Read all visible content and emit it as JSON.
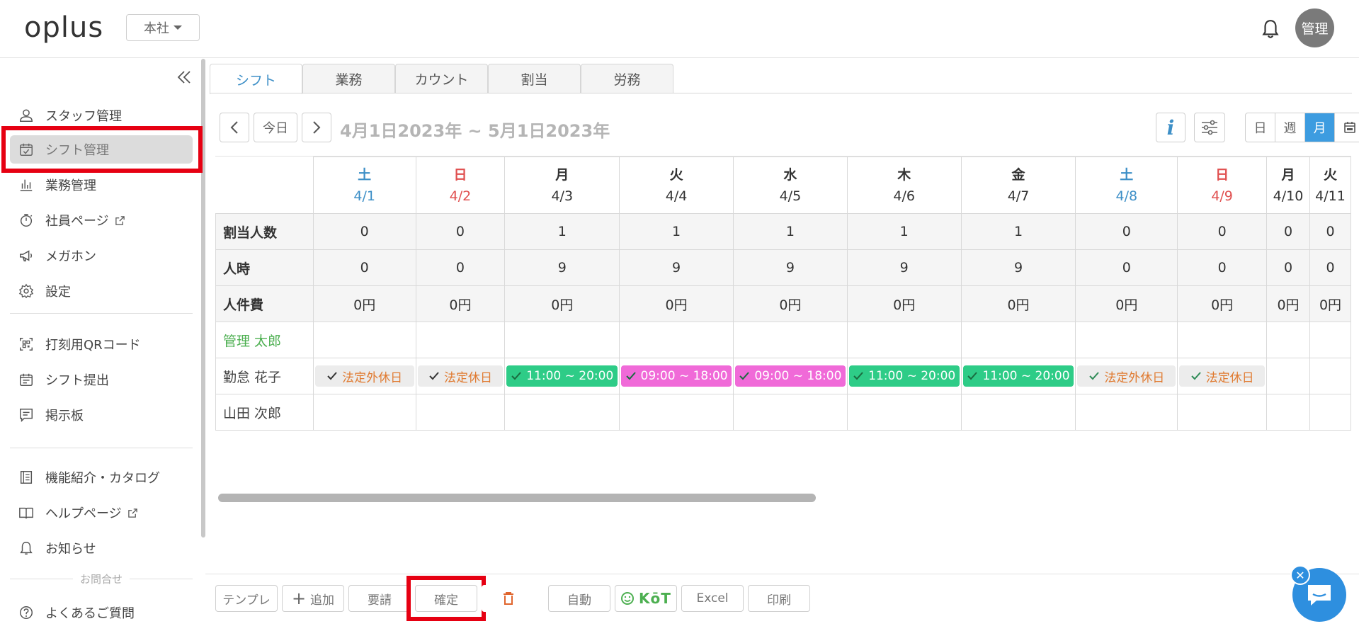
{
  "header": {
    "logo": "oplus",
    "branch": "本社",
    "avatar": "管理"
  },
  "sidebar": {
    "items": [
      {
        "label": "スタッフ管理",
        "icon": "user-icon"
      },
      {
        "label": "シフト管理",
        "icon": "calendar-check-icon"
      },
      {
        "label": "業務管理",
        "icon": "bar-chart-icon"
      },
      {
        "label": "社員ページ",
        "icon": "stopwatch-icon"
      },
      {
        "label": "メガホン",
        "icon": "megaphone-icon"
      },
      {
        "label": "設定",
        "icon": "gear-icon"
      },
      {
        "label": "打刻用QRコード",
        "icon": "qr-code-icon"
      },
      {
        "label": "シフト提出",
        "icon": "calendar-icon"
      },
      {
        "label": "掲示板",
        "icon": "message-board-icon"
      },
      {
        "label": "機能紹介・カタログ",
        "icon": "book-icon"
      },
      {
        "label": "ヘルプページ",
        "icon": "open-book-icon"
      },
      {
        "label": "お知らせ",
        "icon": "bell-icon"
      },
      {
        "label": "よくあるご質問",
        "icon": "question-icon"
      }
    ],
    "inquiry": "お問合せ"
  },
  "tabs": [
    "シフト",
    "業務",
    "カウント",
    "割当",
    "労務"
  ],
  "toolbar": {
    "today": "今日",
    "date_range": "4月1日2023年 ~ 5月1日2023年",
    "views": [
      "日",
      "週",
      "月"
    ]
  },
  "table": {
    "days": [
      {
        "dow": "土",
        "date": "4/1",
        "kind": "sat"
      },
      {
        "dow": "日",
        "date": "4/2",
        "kind": "sun"
      },
      {
        "dow": "月",
        "date": "4/3",
        "kind": "wd"
      },
      {
        "dow": "火",
        "date": "4/4",
        "kind": "wd"
      },
      {
        "dow": "水",
        "date": "4/5",
        "kind": "wd"
      },
      {
        "dow": "木",
        "date": "4/6",
        "kind": "wd"
      },
      {
        "dow": "金",
        "date": "4/7",
        "kind": "wd"
      },
      {
        "dow": "土",
        "date": "4/8",
        "kind": "sat"
      },
      {
        "dow": "日",
        "date": "4/9",
        "kind": "sun"
      },
      {
        "dow": "月",
        "date": "4/10",
        "kind": "wd"
      },
      {
        "dow": "火",
        "date": "4/11",
        "kind": "wd"
      }
    ],
    "stats": [
      {
        "label": "割当人数",
        "values": [
          "0",
          "0",
          "1",
          "1",
          "1",
          "1",
          "1",
          "0",
          "0",
          "0",
          "0"
        ]
      },
      {
        "label": "人時",
        "values": [
          "0",
          "0",
          "9",
          "9",
          "9",
          "9",
          "9",
          "0",
          "0",
          "0",
          "0"
        ]
      },
      {
        "label": "人件費",
        "values": [
          "0円",
          "0円",
          "0円",
          "0円",
          "0円",
          "0円",
          "0円",
          "0円",
          "0円",
          "0円",
          "0円"
        ]
      }
    ],
    "staff": [
      {
        "name": "管理 太郎",
        "green": true,
        "shifts": []
      },
      {
        "name": "勤怠 花子",
        "green": false,
        "shifts": [
          {
            "text": "法定外休日",
            "style": "gray"
          },
          {
            "text": "法定休日",
            "style": "gray"
          },
          {
            "text": "11:00 ~ 20:00",
            "style": "green"
          },
          {
            "text": "09:00 ~ 18:00",
            "style": "pink"
          },
          {
            "text": "09:00 ~ 18:00",
            "style": "pink"
          },
          {
            "text": "11:00 ~ 20:00",
            "style": "green"
          },
          {
            "text": "11:00 ~ 20:00",
            "style": "green"
          },
          {
            "text": "法定外休日",
            "style": "gray"
          },
          {
            "text": "法定休日",
            "style": "gray"
          }
        ]
      },
      {
        "name": "山田 次郎",
        "green": false,
        "shifts": []
      }
    ]
  },
  "bottom": {
    "template": "テンプレ",
    "add": "追加",
    "request": "要請",
    "confirm": "確定",
    "auto": "自動",
    "kot": "KōT",
    "excel": "Excel",
    "print": "印刷"
  },
  "colors": {
    "accent": "#3d9ce0",
    "highlight": "#e60012",
    "shift_green": "#2ecc87",
    "shift_pink": "#f06ad8"
  }
}
